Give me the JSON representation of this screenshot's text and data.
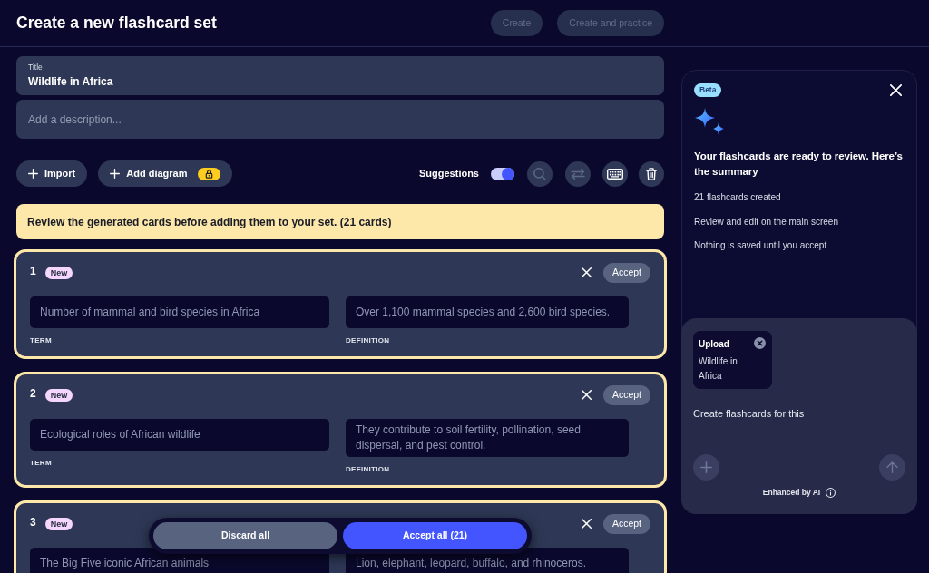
{
  "header": {
    "title": "Create a new flashcard set",
    "buttons": [
      {
        "label": "Create",
        "disabled": true
      },
      {
        "label": "Create and practice",
        "disabled": true
      }
    ]
  },
  "title_field": {
    "label": "Title",
    "value": "Wildlife in Africa"
  },
  "description_field": {
    "placeholder": "Add a description..."
  },
  "toolbar": {
    "buttons": [
      {
        "label": "Import",
        "locked": false
      },
      {
        "label": "Add diagram",
        "locked": true
      }
    ],
    "suggestions": {
      "label": "Suggestions",
      "on": true
    },
    "icon_buttons": [
      {
        "kind": "search",
        "disabled": true
      },
      {
        "kind": "swap",
        "disabled": true
      },
      {
        "kind": "keyboard",
        "disabled": false
      },
      {
        "kind": "delete",
        "disabled": false
      }
    ]
  },
  "notice": "Review the generated cards before adding them to your set. (21 cards)",
  "cards": [
    {
      "number": "1",
      "badge": "New",
      "term": "Number of mammal and bird species in Africa",
      "term_label": "TERM",
      "definition": "Over 1,100 mammal species and 2,600 bird species.",
      "definition_label": "DEFINITION",
      "accept": "Accept"
    },
    {
      "number": "2",
      "badge": "New",
      "term": "Ecological roles of African wildlife",
      "term_label": "TERM",
      "definition": "They contribute to soil fertility, pollination, seed dispersal, and pest control.",
      "definition_label": "DEFINITION",
      "accept": "Accept"
    },
    {
      "number": "3",
      "badge": "New",
      "term": "The Big Five iconic African animals",
      "definition": "Lion, elephant, leopard, buffalo, and rhinoceros.",
      "accept": "Accept"
    }
  ],
  "bulk_actions": [
    {
      "label": "Discard all",
      "kind": "secondary"
    },
    {
      "label": "Accept all (21)",
      "kind": "primary"
    }
  ],
  "assistant": {
    "badge": "Beta",
    "heading": "Your flashcards are ready to review. Here’s the summary",
    "summary": [
      "21 flashcards created",
      "Review and edit on the main screen",
      "Nothing is saved until you accept"
    ],
    "attachment": {
      "label": "Upload",
      "name": "Wildlife in Africa"
    },
    "prompt": "Create flashcards for this",
    "footer": "Enhanced by AI"
  }
}
